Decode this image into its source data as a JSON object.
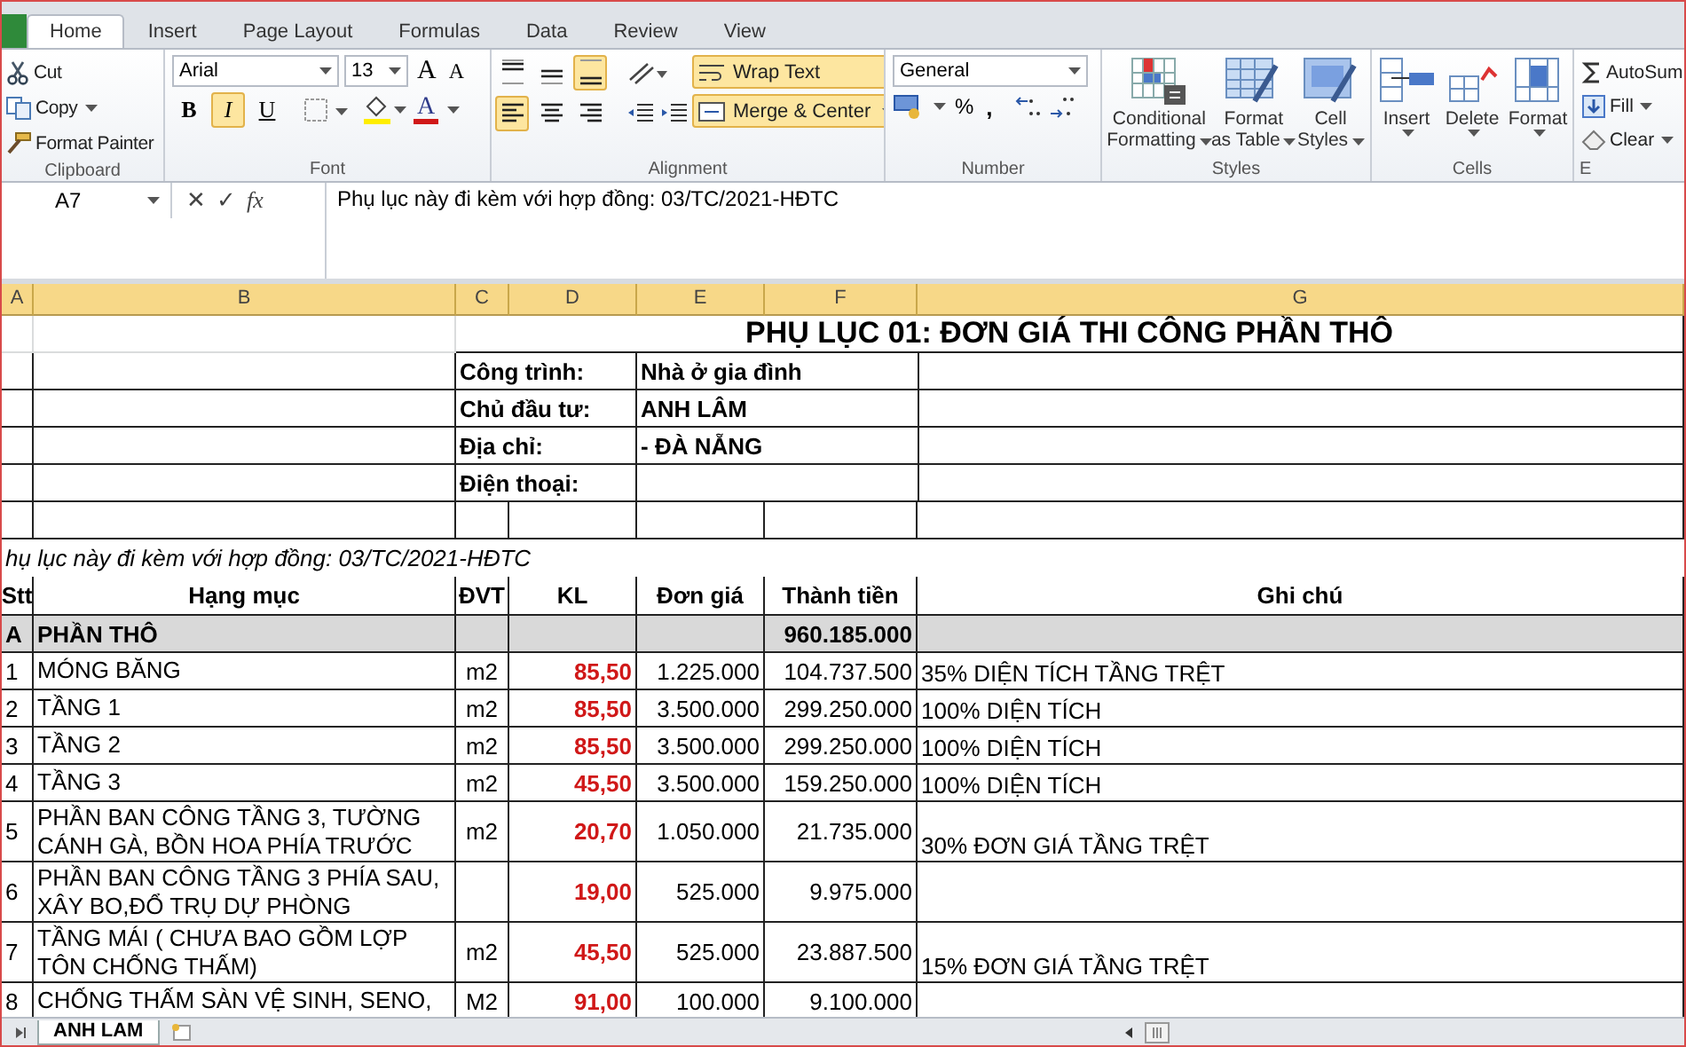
{
  "ribbon": {
    "tabs": [
      {
        "label": "Home",
        "selected": true
      },
      {
        "label": "Insert",
        "selected": false
      },
      {
        "label": "Page Layout",
        "selected": false
      },
      {
        "label": "Formulas",
        "selected": false
      },
      {
        "label": "Data",
        "selected": false
      },
      {
        "label": "Review",
        "selected": false
      },
      {
        "label": "View",
        "selected": false
      }
    ],
    "clipboard": {
      "label": "Clipboard",
      "commands": [
        {
          "kind": "cut",
          "label": "Cut",
          "dropdown": false
        },
        {
          "kind": "copy",
          "label": "Copy",
          "dropdown": true
        },
        {
          "kind": "painter",
          "label": "Format Painter",
          "dropdown": false
        }
      ]
    },
    "font": {
      "label": "Font",
      "family": "Arial",
      "size": "13",
      "grow_glyph": "A",
      "shrink_glyph": "A",
      "color_glyph": "A",
      "toggles": [
        {
          "kind": "bold",
          "glyph": "B",
          "selected": false
        },
        {
          "kind": "italic",
          "glyph": "I",
          "selected": true
        },
        {
          "kind": "underline",
          "glyph": "U",
          "selected": false
        }
      ]
    },
    "alignment": {
      "label": "Alignment",
      "vertical": [
        {
          "kind": "top",
          "selected": false
        },
        {
          "kind": "middle",
          "selected": false
        },
        {
          "kind": "bottom",
          "selected": true
        }
      ],
      "horizontal": [
        {
          "kind": "left",
          "selected": true
        },
        {
          "kind": "center",
          "selected": false
        },
        {
          "kind": "right",
          "selected": false
        }
      ],
      "wrap_text": {
        "label": "Wrap Text",
        "selected": true
      },
      "merge": {
        "label": "Merge & Center",
        "selected": true
      }
    },
    "number": {
      "label": "Number",
      "format": "General",
      "percent_glyph": "%",
      "comma_glyph": ","
    },
    "styles": {
      "label": "Styles",
      "commands": [
        {
          "kind": "conditional",
          "lines": [
            "Conditional",
            "Formatting"
          ]
        },
        {
          "kind": "table",
          "lines": [
            "Format",
            "as Table"
          ]
        },
        {
          "kind": "cellstyles",
          "lines": [
            "Cell",
            "Styles"
          ]
        }
      ]
    },
    "cells": {
      "label": "Cells",
      "commands": [
        {
          "kind": "insert",
          "label": "Insert"
        },
        {
          "kind": "delete",
          "label": "Delete"
        },
        {
          "kind": "format",
          "label": "Format"
        }
      ]
    },
    "editing": {
      "label": "E",
      "commands": [
        {
          "kind": "autosum",
          "label": "AutoSum"
        },
        {
          "kind": "fill",
          "label": "Fill"
        },
        {
          "kind": "clear",
          "label": "Clear"
        }
      ]
    }
  },
  "formula_bar": {
    "name_box": "A7",
    "cancel_glyph": "✕",
    "enter_glyph": "✓",
    "function_glyph": "fx",
    "formula": "Phụ lục này đi kèm với hợp đồng: 03/TC/2021-HĐTC"
  },
  "sheet": {
    "columns": [
      "A",
      "B",
      "C",
      "D",
      "E",
      "F",
      "G"
    ],
    "rows": [
      {
        "kind": "title",
        "text": "PHỤ LỤC 01: ĐƠN GIÁ THI CÔNG PHẦN THÔ"
      },
      {
        "kind": "info",
        "label": "Công trình:",
        "value": "Nhà ở gia đình"
      },
      {
        "kind": "info",
        "label": "Chủ đầu tư:",
        "value": "ANH LÂM"
      },
      {
        "kind": "info",
        "label": "Địa chỉ:",
        "value": " - ĐÀ NẴNG"
      },
      {
        "kind": "info",
        "label": "Điện thoại:"
      },
      {
        "kind": "blank"
      },
      {
        "kind": "note",
        "text": "hụ lục này đi kèm với hợp đồng: 03/TC/2021-HĐTC"
      },
      {
        "kind": "header",
        "cells": [
          "Stt",
          "Hạng mục",
          "ĐVT",
          "KL",
          "Đơn giá",
          "Thành tiền",
          "Ghi chú"
        ]
      },
      {
        "kind": "section",
        "stt": "A",
        "name": "PHẦN THÔ",
        "amount": "960.185.000"
      },
      {
        "kind": "item",
        "stt": "1",
        "name": "MÓNG BĂNG",
        "unit": "m2",
        "qty": "85,50",
        "price": "1.225.000",
        "amount": "104.737.500",
        "note": "35% DIỆN TÍCH TẦNG TRỆT"
      },
      {
        "kind": "item",
        "stt": "2",
        "name": "TẦNG 1",
        "unit": "m2",
        "qty": "85,50",
        "price": "3.500.000",
        "amount": "299.250.000",
        "note": "100% DIỆN TÍCH"
      },
      {
        "kind": "item",
        "stt": "3",
        "name": "TẦNG 2",
        "unit": "m2",
        "qty": "85,50",
        "price": "3.500.000",
        "amount": "299.250.000",
        "note": "100% DIỆN TÍCH"
      },
      {
        "kind": "item",
        "stt": "4",
        "name": "TẦNG 3",
        "unit": "m2",
        "qty": "45,50",
        "price": "3.500.000",
        "amount": "159.250.000",
        "note": "100% DIỆN TÍCH"
      },
      {
        "kind": "item",
        "stt": "5",
        "name": "PHẦN BAN CÔNG TẦNG 3, TƯỜNG CÁNH GÀ, BỒN HOA PHÍA TRƯỚC",
        "unit": "m2",
        "qty": "20,70",
        "price": "1.050.000",
        "amount": "21.735.000",
        "note": "30% ĐƠN GIÁ TẦNG TRỆT"
      },
      {
        "kind": "item",
        "stt": "6",
        "name": "PHẦN BAN CÔNG TẦNG 3 PHÍA SAU, XÂY BO,ĐỔ TRỤ DỰ PHÒNG",
        "qty": "19,00",
        "price": "525.000",
        "amount": "9.975.000"
      },
      {
        "kind": "item",
        "stt": "7",
        "name": "TẦNG MÁI ( CHƯA BAO GỒM LỢP TÔN CHỐNG THẤM)",
        "unit": "m2",
        "qty": "45,50",
        "price": "525.000",
        "amount": "23.887.500",
        "note": "15% ĐƠN GIÁ TẦNG TRỆT"
      },
      {
        "kind": "item",
        "stt": "8",
        "name": "CHỐNG THẤM SÀN VỆ SINH, SENO,",
        "unit": "M2",
        "qty": "91,00",
        "price": "100.000",
        "amount": "9.100.000"
      }
    ]
  },
  "sheet_tabs": [
    {
      "label": "ANH LAM",
      "selected": true
    }
  ]
}
